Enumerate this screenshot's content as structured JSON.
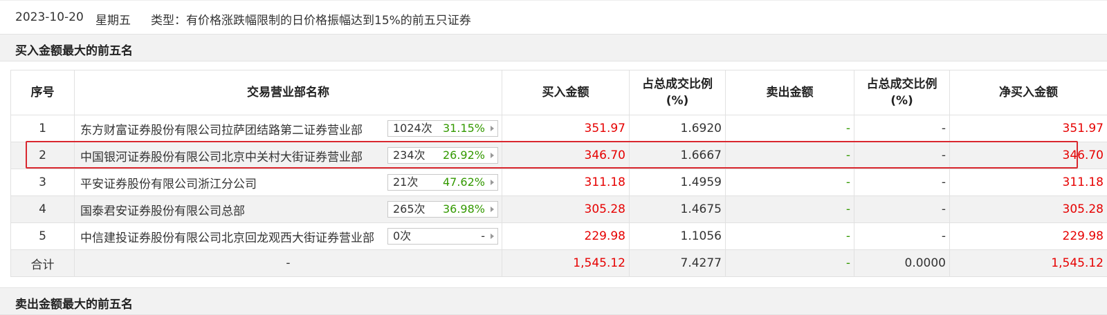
{
  "info": {
    "date": "2023-10-20",
    "weekday": "星期五",
    "type": "类型：有价格涨跌幅限制的日价格振幅达到15%的前五只证券"
  },
  "buy_section": {
    "title": "买入金额最大的前五名"
  },
  "sell_section": {
    "title": "卖出金额最大的前五名"
  },
  "columns": {
    "seq": "序号",
    "name": "交易营业部名称",
    "buy": "买入金额",
    "buy_ratio": "占总成交比例\n(%)",
    "sell": "卖出金额",
    "sell_ratio": "占总成交比例\n(%)",
    "net": "净买入金额"
  },
  "rows": [
    {
      "seq": "1",
      "name": "东方财富证券股份有限公司拉萨团结路第二证券营业部",
      "count": "1024次",
      "rate": "31.15%",
      "buy": "351.97",
      "buy_ratio": "1.6920",
      "sell": "-",
      "sell_ratio": "-",
      "net": "351.97"
    },
    {
      "seq": "2",
      "name": "中国银河证券股份有限公司北京中关村大街证券营业部",
      "count": "234次",
      "rate": "26.92%",
      "buy": "346.70",
      "buy_ratio": "1.6667",
      "sell": "-",
      "sell_ratio": "-",
      "net": "346.70"
    },
    {
      "seq": "3",
      "name": "平安证券股份有限公司浙江分公司",
      "count": "21次",
      "rate": "47.62%",
      "buy": "311.18",
      "buy_ratio": "1.4959",
      "sell": "-",
      "sell_ratio": "-",
      "net": "311.18"
    },
    {
      "seq": "4",
      "name": "国泰君安证券股份有限公司总部",
      "count": "265次",
      "rate": "36.98%",
      "buy": "305.28",
      "buy_ratio": "1.4675",
      "sell": "-",
      "sell_ratio": "-",
      "net": "305.28"
    },
    {
      "seq": "5",
      "name": "中信建投证券股份有限公司北京回龙观西大街证券营业部",
      "count": "0次",
      "rate": "-",
      "buy": "229.98",
      "buy_ratio": "1.1056",
      "sell": "-",
      "sell_ratio": "-",
      "net": "229.98"
    }
  ],
  "total": {
    "label": "合计",
    "name": "-",
    "buy": "1,545.12",
    "buy_ratio": "7.4277",
    "sell": "-",
    "sell_ratio": "0.0000",
    "net": "1,545.12"
  },
  "colors": {
    "red": "#e60000",
    "green": "#339900",
    "highlight": "#d9272e"
  }
}
